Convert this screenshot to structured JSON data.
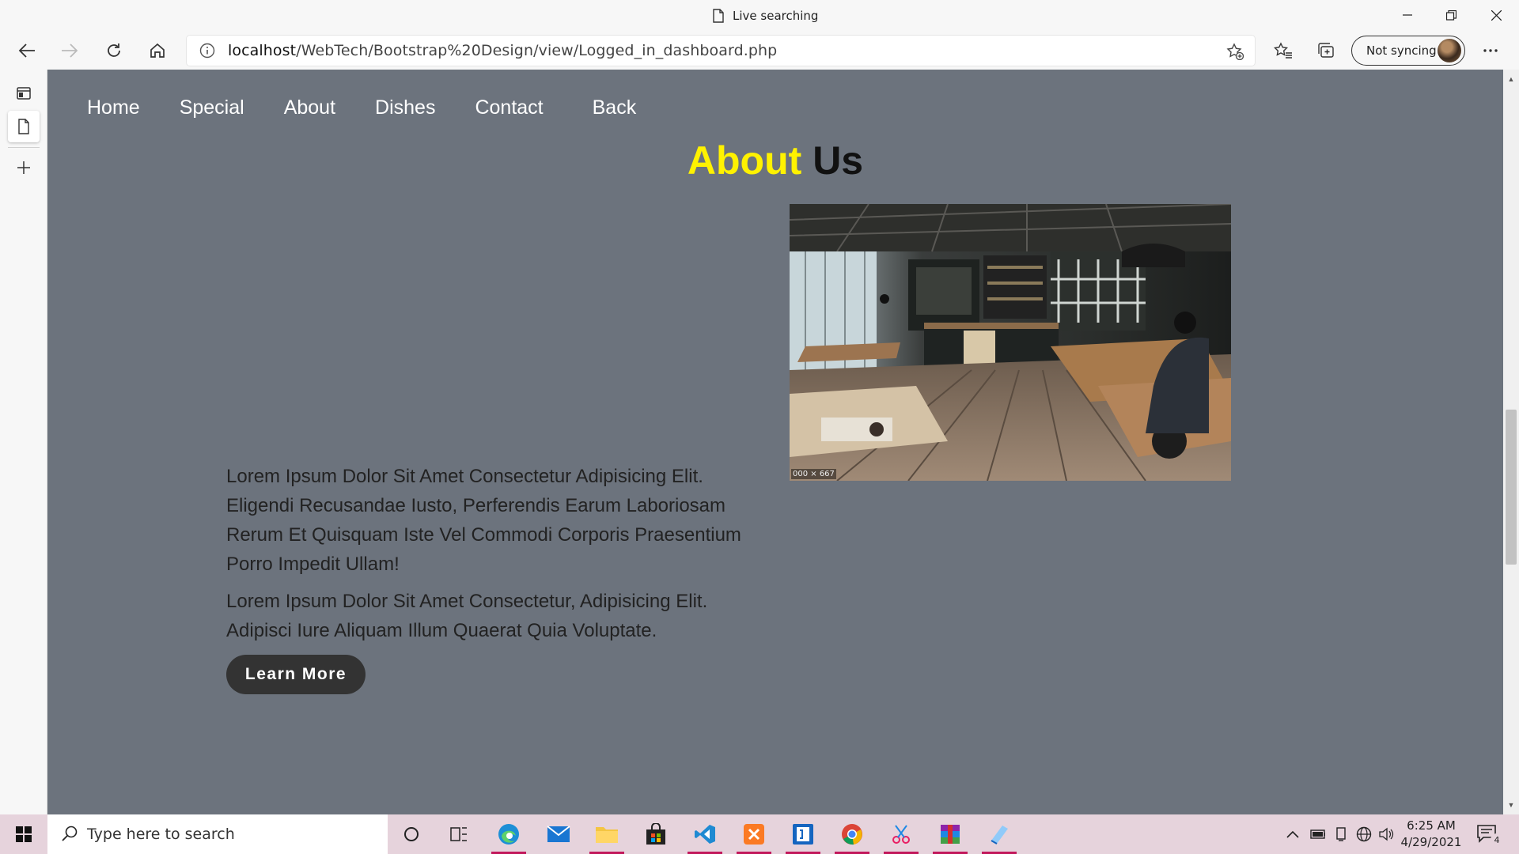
{
  "browser": {
    "tab_title": "Live searching",
    "url_host": "localhost",
    "url_path": "/WebTech/Bootstrap%20Design/view/Logged_in_dashboard.php",
    "sync_label": "Not syncing",
    "icons": [
      "back-icon",
      "forward-icon",
      "refresh-icon",
      "home-icon",
      "info-icon",
      "add-favorite-icon",
      "favorites-icon",
      "collections-icon",
      "more-icon"
    ]
  },
  "page": {
    "nav": [
      "Home",
      "Special",
      "About",
      "Dishes",
      "Contact",
      "Back"
    ],
    "heading_accent": "About",
    "heading_rest": "Us",
    "image_badge": "000 × 667",
    "paragraph1": "Lorem Ipsum Dolor Sit Amet Consectetur Adipisicing Elit. Eligendi Recusandae Iusto, Perferendis Earum Laboriosam Rerum Et Quisquam Iste Vel Commodi Corporis Praesentium Porro Impedit Ullam!",
    "paragraph2": "Lorem Ipsum Dolor Sit Amet Consectetur, Adipisicing Elit. Adipisci Iure Aliquam Illum Quaerat Quia Voluptate.",
    "button_label": "Learn More",
    "colors": {
      "background": "#6c737d",
      "accent": "#fff200",
      "button": "#333333"
    }
  },
  "taskbar": {
    "search_placeholder": "Type here to search",
    "time": "6:25 AM",
    "date": "4/29/2021",
    "notification_count": "4",
    "apps": [
      "cortana",
      "task-view",
      "edge",
      "mail",
      "file-explorer",
      "store",
      "vscode",
      "xampp",
      "app",
      "chrome",
      "snip",
      "winrar",
      "app"
    ]
  }
}
